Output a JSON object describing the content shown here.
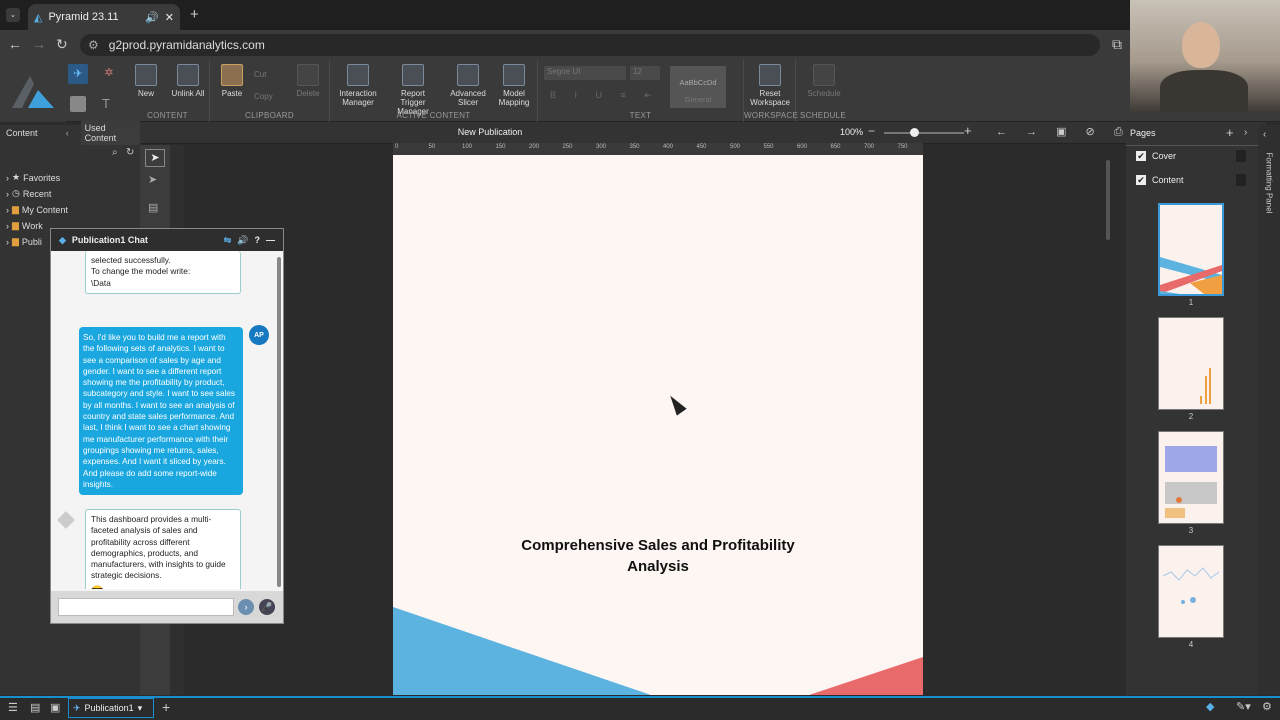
{
  "browser": {
    "tab_title": "Pyramid 23.11",
    "url": "g2prod.pyramidanalytics.com"
  },
  "ribbon": {
    "groups": {
      "content": "CONTENT",
      "clipboard": "CLIPBOARD",
      "active_content": "ACTIVE CONTENT",
      "text": "TEXT",
      "workspace": "WORKSPACE",
      "schedule": "SCHEDULE"
    },
    "buttons": {
      "new": "New",
      "unlink_all": "Unlink All",
      "paste": "Paste",
      "cut": "Cut",
      "copy": "Copy",
      "delete": "Delete",
      "interaction_manager": "Interaction Manager",
      "report_trigger_manager": "Report Trigger Manager",
      "advanced_slicer": "Advanced Slicer",
      "model_mapping": "Model Mapping",
      "font": "Segoe UI",
      "font_size": "12",
      "style_preview": "AaBbCcDd",
      "style_name": "General",
      "reset_workspace": "Reset Workspace",
      "schedule": "Schedule"
    }
  },
  "left_panel": {
    "tab_content": "Content",
    "tab_used": "Used Content",
    "tree": [
      "Favorites",
      "Recent",
      "My Content",
      "Work",
      "Publi"
    ]
  },
  "chat": {
    "title": "Publication1 Chat",
    "bot_msg_1": "selected successfully.\nTo change the model write:\n\\Data",
    "user_msg": "So, I'd like you to build me a report with the following sets of analytics. I want to see a comparison of sales by age and gender. I want to see a different report showing me the profitability by product, subcategory and style. I want to see sales by all months. I want to see an analysis of country and state sales performance. And last, I think I want to see a chart showing me manufacturer performance with their groupings showing me returns, sales, expenses. And I want it sliced by years. And please do add some report-wide insights.",
    "user_initials": "AP",
    "bot_msg_2": "This dashboard provides a multi-faceted analysis of sales and profitability across different demographics, products, and manufacturers, with insights to guide strategic decisions.",
    "emoji": "😎"
  },
  "canvas": {
    "title": "New Publication",
    "zoom": "100%",
    "ruler_ticks": [
      "0",
      "50",
      "100",
      "150",
      "200",
      "250",
      "300",
      "350",
      "400",
      "450",
      "500",
      "550",
      "600",
      "650",
      "700",
      "750"
    ],
    "cover_title": "Comprehensive Sales and Profitability Analysis"
  },
  "pages_panel": {
    "title": "Pages",
    "sections": [
      "Cover",
      "Content"
    ],
    "page_numbers": [
      "1",
      "2",
      "3",
      "4"
    ],
    "formatting_panel": "Formatting Panel"
  },
  "bottom": {
    "doc_tab": "Publication1"
  },
  "colors": {
    "accent_blue": "#1aa7df",
    "cover_blue": "#5cb3e0",
    "cover_red": "#e86a6a",
    "cover_orange": "#f0a040"
  }
}
